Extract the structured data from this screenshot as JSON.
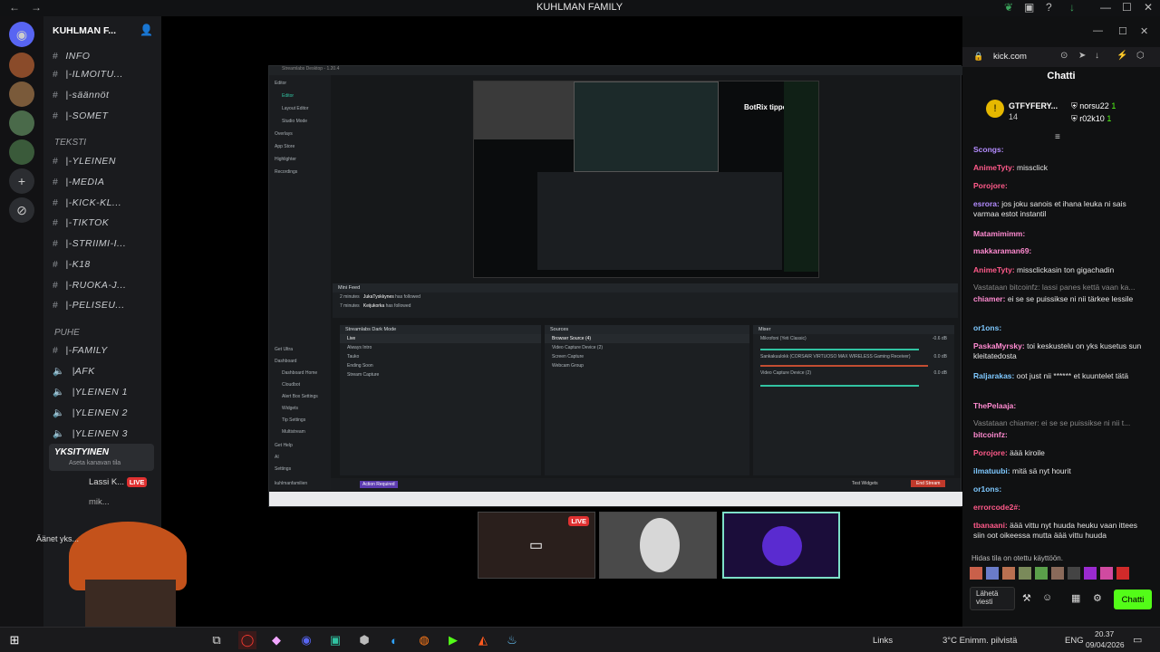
{
  "window": {
    "title": "KUHLMAN FAMILY"
  },
  "discord": {
    "server_name": "KUHLMAN F...",
    "categories": {
      "info": "INFO",
      "teksti": "TEKSTI",
      "puhe": "PUHE"
    },
    "channels": [
      {
        "name": "INFO",
        "kind": "category"
      },
      {
        "name": "|-ILMOITU...",
        "kind": "text"
      },
      {
        "name": "|-säännöt",
        "kind": "text"
      },
      {
        "name": "|-SOMET",
        "kind": "text"
      },
      {
        "name": "|-YLEINEN",
        "kind": "text"
      },
      {
        "name": "|-MEDIA",
        "kind": "text"
      },
      {
        "name": "|-KICK-KL...",
        "kind": "text"
      },
      {
        "name": "|-TIKTOK",
        "kind": "text"
      },
      {
        "name": "|-STRIIMI-I...",
        "kind": "text"
      },
      {
        "name": "|-K18",
        "kind": "text"
      },
      {
        "name": "|-RUOKA-J...",
        "kind": "text"
      },
      {
        "name": "|-PELISEU...",
        "kind": "text"
      },
      {
        "name": "|-FAMILY",
        "kind": "text"
      },
      {
        "name": "|AFK",
        "kind": "voice"
      },
      {
        "name": "|YLEINEN 1",
        "kind": "voice"
      },
      {
        "name": "|YLEINEN 2",
        "kind": "voice"
      },
      {
        "name": "|YLEINEN 3",
        "kind": "voice"
      },
      {
        "name": "YKSITYINEN",
        "kind": "voice"
      }
    ],
    "voice_status": "Aseta kanavan tila",
    "voice_users": [
      {
        "name": "Lassi K...",
        "badge": "LIVE"
      },
      {
        "name": "mik..."
      }
    ],
    "bottom_text": "Äänet yks..."
  },
  "obs": {
    "title": "Streamlabs Desktop - 1.20.4",
    "left_nav": [
      "Editor",
      "Editor",
      "Layout Editor",
      "Studio Mode",
      "Overlays",
      "App Store",
      "Highlighter",
      "Recordings"
    ],
    "left_nav_bottom": [
      "Get Ultra",
      "Dashboard",
      "Dashboard Home",
      "Cloudbot",
      "Alert Box Settings",
      "Widgets",
      "Tip Settings",
      "Multistream",
      "Get Help",
      "AI",
      "Settings",
      "kuhlmanfamilien"
    ],
    "overlay_text": "BotRix tipped 100$!",
    "mini_feed": {
      "title": "Mini Feed",
      "events": [
        {
          "time": "2 minutes",
          "user": "JukaTyskkynes",
          "action": "has followed"
        },
        {
          "time": "7 minutes",
          "user": "Keijukorka",
          "action": "has followed"
        }
      ]
    },
    "scenes": {
      "title": "Streamlabs Dark Mode",
      "items": [
        "Live",
        "Always Intro",
        "Tauko",
        "Ending Soon",
        "Stream Capture"
      ]
    },
    "sources": {
      "title": "Sources",
      "items": [
        "Browser Source (4)",
        "Video Capture Device (2)",
        "Screen Capture",
        "Webcam Group"
      ]
    },
    "mixer": {
      "title": "Mixer",
      "items": [
        {
          "name": "Mikrofoni (Yeti Classic)",
          "level": "-0.6 dB"
        },
        {
          "name": "Sankakuulokk (CORSAIR VIRTUOSO MAX WIRELESS Gaming Receiver)",
          "level": "0.0 dB"
        },
        {
          "name": "Video Capture Device (2)",
          "level": "0.0 dB"
        }
      ]
    },
    "bottom": {
      "action": "Action Required",
      "test": "Test Widgets",
      "go": "End Stream"
    }
  },
  "thumbs": [
    {
      "badge": "LIVE"
    },
    {},
    {}
  ],
  "browser": {
    "url": "kick.com"
  },
  "chat": {
    "title": "Chatti",
    "top_gifters": [
      {
        "name": "GTFYFERY...",
        "count": "14"
      },
      {
        "name": "norsu22",
        "count": "1"
      },
      {
        "name": "r02k10",
        "count": "1"
      }
    ],
    "messages": [
      {
        "user": "Scongs:",
        "text": "",
        "color": "#b48cff"
      },
      {
        "user": "AnimeTyty:",
        "text": "missclick",
        "color": "#ff5a8a"
      },
      {
        "user": "Porojore:",
        "text": "",
        "color": "#ff5a8a"
      },
      {
        "user": "esrora:",
        "text": "jos joku sanois et ihana leuka ni sais varmaa estot instantil",
        "color": "#b48cff"
      },
      {
        "user": "Matamimimm:",
        "text": "",
        "color": "#ff8ad0"
      },
      {
        "user": "makkaraman69:",
        "text": "",
        "color": "#ff8ad0"
      },
      {
        "user": "AnimeTyty:",
        "text": "missclickasin ton gigachadin",
        "color": "#ff5a8a"
      },
      {
        "user": "",
        "text": "Vastataan bitcoinfz: lassi panes kettä vaan ka...",
        "color": "#888"
      },
      {
        "user": "chiamer:",
        "text": "ei se se puissikse ni nii tärkee lessile",
        "color": "#ff8ad0"
      },
      {
        "user": "or1ons:",
        "text": "",
        "color": "#7ec8ff"
      },
      {
        "user": "PaskaMyrsky:",
        "text": "toi keskustelu on yks kusetus sun kleitatedosta",
        "color": "#ff8ad0"
      },
      {
        "user": "Raljarakas:",
        "text": "oot just nii ****** et kuuntelet tätä",
        "color": "#7ec8ff"
      },
      {
        "user": "ThePelaaja:",
        "text": "",
        "color": "#ff8ad0"
      },
      {
        "user": "",
        "text": "Vastataan chiamer: ei se se puissikse ni nii t...",
        "color": "#888"
      },
      {
        "user": "bitcoinfz:",
        "text": "",
        "color": "#ff8ad0"
      },
      {
        "user": "Porojore:",
        "text": "äää kiroile",
        "color": "#ff5a8a"
      },
      {
        "user": "ilmatuubi:",
        "text": "mitä sä nyt hourit",
        "color": "#7ec8ff"
      },
      {
        "user": "or1ons:",
        "text": "",
        "color": "#7ec8ff"
      },
      {
        "user": "errorcode2#:",
        "text": "",
        "color": "#ff5a8a"
      },
      {
        "user": "tbanaani:",
        "text": "äää vittu nyt huuda heuku vaan ittees siin oot oikeessa mutta äää vittu huuda",
        "color": "#ff5a8a"
      }
    ],
    "slow_mode": "Hidas tila on otettu käyttöön.",
    "input_placeholder": "Lähetä viesti",
    "send_label": "Chatti"
  },
  "taskbar": {
    "links": "Links",
    "weather": "3°C Enimm. pilvistä",
    "lang": "ENG",
    "time": "20.37",
    "date": "09/04/2026"
  }
}
